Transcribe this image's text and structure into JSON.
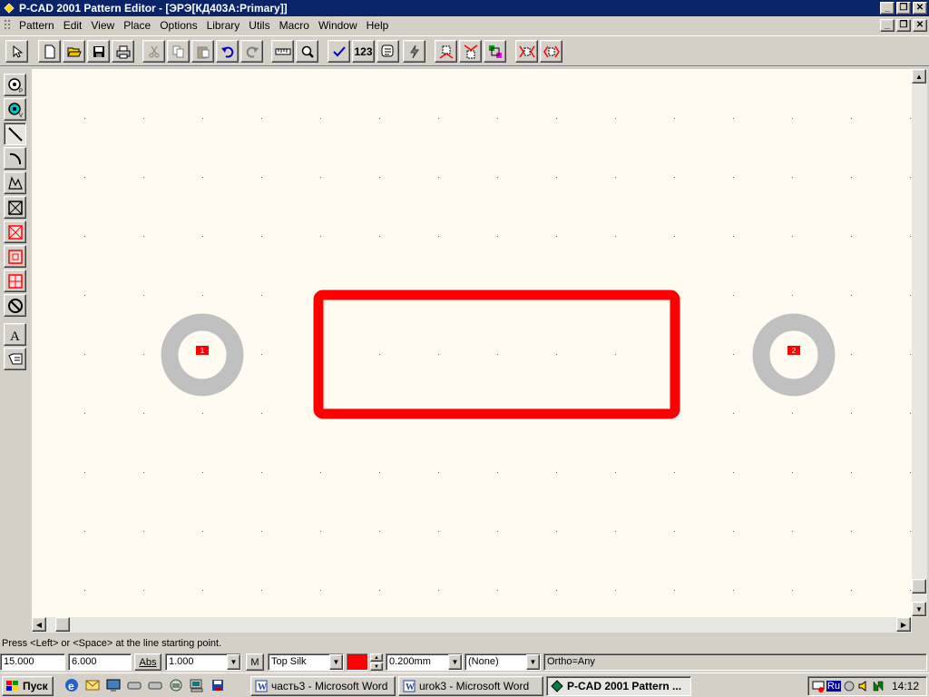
{
  "window": {
    "title": "P-CAD 2001 Pattern Editor - [ЭРЭ[КД403А:Primary]]"
  },
  "menu": [
    "Pattern",
    "Edit",
    "View",
    "Place",
    "Options",
    "Library",
    "Utils",
    "Macro",
    "Window",
    "Help"
  ],
  "toolbar": {
    "num_label": "123"
  },
  "pads": [
    {
      "label": "1"
    },
    {
      "label": "2"
    }
  ],
  "status": {
    "prompt": "Press <Left> or <Space> at the line starting point."
  },
  "bottom": {
    "x": "15.000",
    "y": "6.000",
    "abs_label": "Abs",
    "grid": "1.000",
    "m_label": "M",
    "layer": "Top Silk",
    "layer_color": "#ff0000",
    "width": "0.200mm",
    "none": "(None)",
    "ortho": "Ortho=Any"
  },
  "taskbar": {
    "start": "Пуск",
    "tasks": [
      "часть3 - Microsoft Word",
      "urok3 - Microsoft Word",
      "P-CAD 2001 Pattern ..."
    ],
    "lang": "Ru",
    "time": "14:12"
  },
  "colors": {
    "silk": "#ff0000",
    "pad_ring": "#c0c0c0",
    "canvas": "#fffbf0",
    "title_bar": "#0a246a"
  }
}
